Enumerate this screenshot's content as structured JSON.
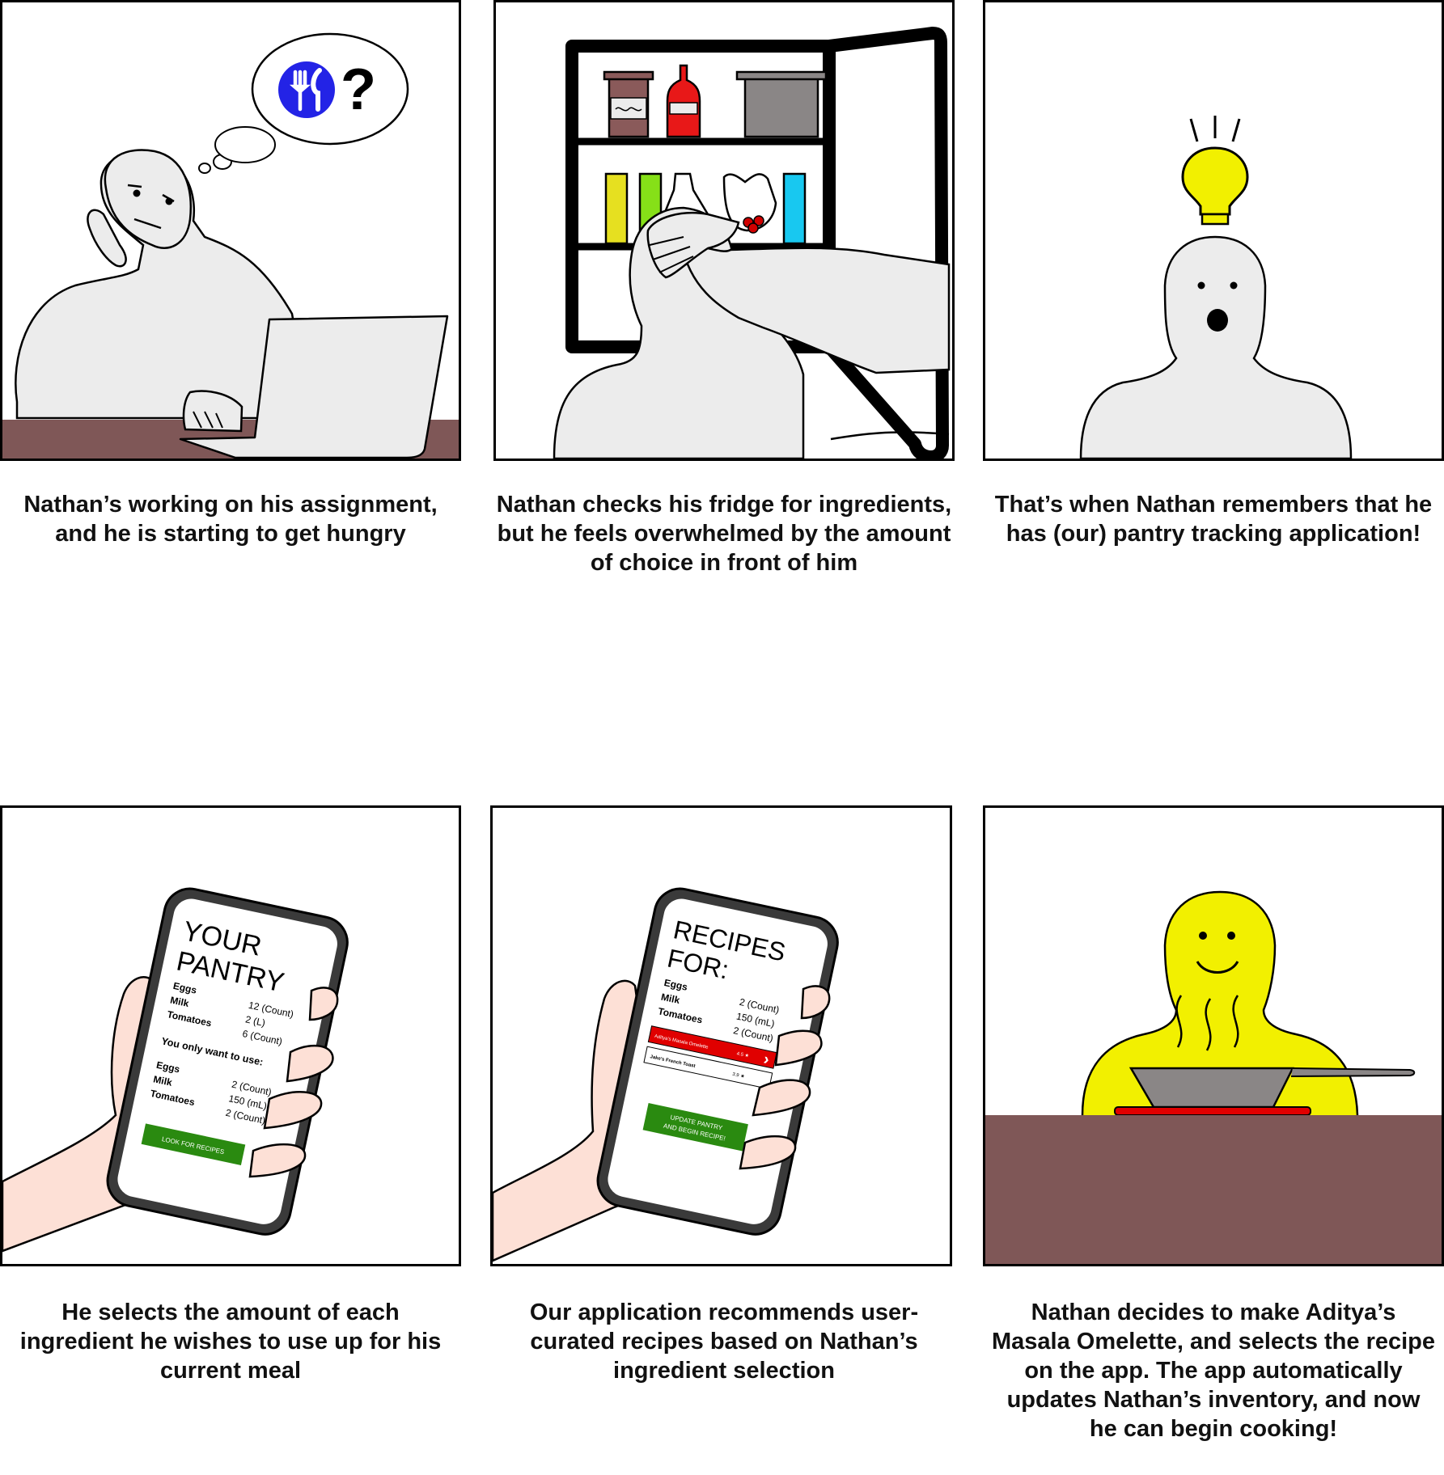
{
  "panels": [
    {
      "caption": "Nathan’s working on his assignment, and he is starting to get hungry",
      "thought_symbol": "?"
    },
    {
      "caption": "Nathan checks his fridge for ingredients, but he feels overwhelmed by the amount of choice in front of him"
    },
    {
      "caption": "That’s when Nathan remembers that he has (our) pantry tracking application!"
    },
    {
      "caption": "He selects the amount of each ingredient he wishes to use up for his current meal",
      "screen": {
        "title_line1": "YOUR",
        "title_line2": "PANTRY",
        "items": [
          {
            "name": "Eggs",
            "qty": "12 (Count)"
          },
          {
            "name": "Milk",
            "qty": "2 (L)"
          },
          {
            "name": "Tomatoes",
            "qty": "6 (Count)"
          }
        ],
        "subheading": "You only want to use:",
        "use_items": [
          {
            "name": "Eggs",
            "qty": "2 (Count)"
          },
          {
            "name": "Milk",
            "qty": "150 (mL)"
          },
          {
            "name": "Tomatoes",
            "qty": "2 (Count)"
          }
        ],
        "button_label": "LOOK FOR RECIPES"
      }
    },
    {
      "caption": "Our application recommends user-curated recipes based on Nathan’s ingredient selection",
      "screen": {
        "title_line1": "RECIPES",
        "title_line2": "FOR:",
        "items": [
          {
            "name": "Eggs",
            "qty": "2 (Count)"
          },
          {
            "name": "Milk",
            "qty": "150 (mL)"
          },
          {
            "name": "Tomatoes",
            "qty": "2 (Count)"
          }
        ],
        "recipes": [
          {
            "name": "Aditya's Masala Omelette",
            "rating": "4.5 ★"
          },
          {
            "name": "Jake's French Toast",
            "rating": "3.9 ★"
          }
        ],
        "chevron": "›",
        "button_line1": "UPDATE PANTRY",
        "button_line2": "AND BEGIN RECIPE!"
      }
    },
    {
      "caption": "Nathan decides to make Aditya’s Masala Omelette, and selects the recipe on the app. The app automatically updates Nathan’s inventory, and now he can begin cooking!"
    }
  ],
  "colors": {
    "skin": "#ececec",
    "desk": "#7f5757",
    "hand": "#fde0d6",
    "app_green": "#2a8a10",
    "app_red": "#e00000",
    "bulb": "#f2f000",
    "icon_blue": "#2323e6"
  }
}
